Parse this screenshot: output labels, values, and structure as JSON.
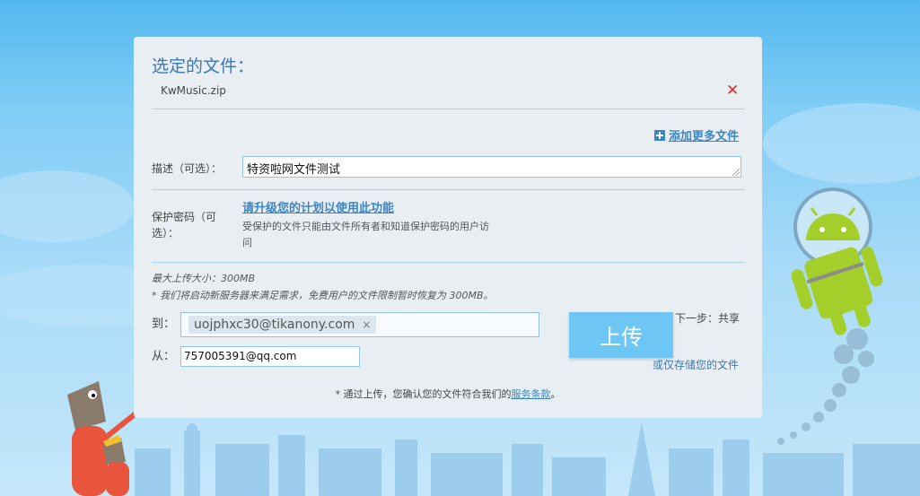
{
  "panel": {
    "title": "选定的文件：",
    "file": {
      "name": "KwMusic.zip",
      "remove_label": "✕"
    },
    "add_more_label": "添加更多文件",
    "description": {
      "label": "描述（可选）：",
      "value": "特资啦网文件测试"
    },
    "password": {
      "label_line1": "保护密码（可",
      "label_line2": "选）：",
      "upgrade_link": "请升级您的计划以使用此功能",
      "note_line1": "受保护的文件只能由文件所有者和知道保护密码的用户访",
      "note_line2": "问"
    },
    "limits": {
      "max_size": "最大上传大小：300MB",
      "notice": "* 我们将启动新服务器来满足需求，免费用户的文件限制暂时恢复为 300MB。"
    },
    "to": {
      "label": "到：",
      "recipient": "uojphxc30@tikanony.com",
      "chip_remove": "×"
    },
    "from": {
      "label": "从：",
      "value": "757005391@qq.com"
    },
    "upload_button": "上传",
    "next_step": "下一步：共享",
    "store_only": "或仅存储您的文件",
    "terms": {
      "prefix": "* 通过上传，您确认您的文件符合我们的",
      "link": "服务条款",
      "suffix": "。"
    }
  },
  "colors": {
    "accent": "#3b86c2",
    "title": "#3c78b4",
    "upload_button": "#6ec6f5",
    "remove": "#d9302b",
    "panel_bg": "#e9eef3"
  },
  "icons": [
    "close-icon",
    "plus-icon",
    "android-mascot",
    "red-characters"
  ]
}
